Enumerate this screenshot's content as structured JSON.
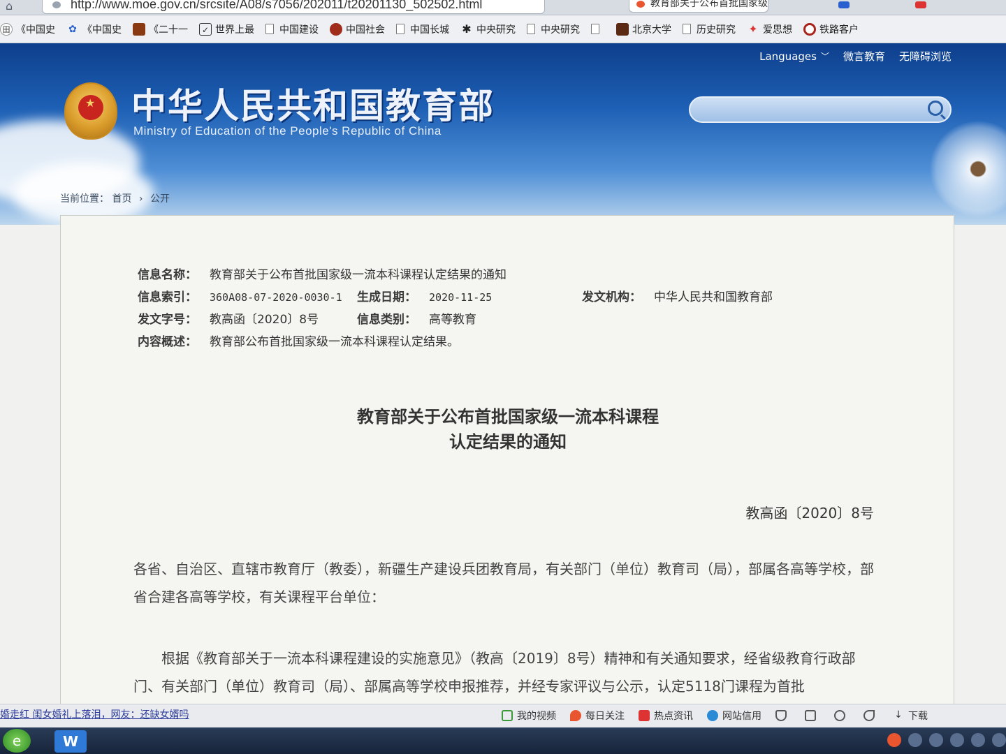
{
  "browser": {
    "url": "http://www.moe.gov.cn/srcsite/A08/s7056/202011/t20201130_502502.html",
    "tab_title": "教育部关于公布首批国家级",
    "bookmarks": [
      {
        "label": "《中国史",
        "icon": "app-icon"
      },
      {
        "label": "《中国史",
        "icon": "paw-icon"
      },
      {
        "label": "《二十一",
        "icon": "book-icon"
      },
      {
        "label": "世界上最",
        "icon": "check-icon"
      },
      {
        "label": "中国建设",
        "icon": "doc-icon"
      },
      {
        "label": "中国社会",
        "icon": "globe-icon"
      },
      {
        "label": "中国长城",
        "icon": "doc-icon"
      },
      {
        "label": "中央研究",
        "icon": "tree-icon"
      },
      {
        "label": "中央研究",
        "icon": "doc-icon"
      },
      {
        "label": "北京大学",
        "icon": "building-icon"
      },
      {
        "label": "历史研究",
        "icon": "doc-icon"
      },
      {
        "label": "爱思想",
        "icon": "star-icon"
      },
      {
        "label": "铁路客户",
        "icon": "train-icon"
      }
    ]
  },
  "site": {
    "top_links": {
      "languages": "Languages",
      "weibo": "微言教育",
      "accessible": "无障碍浏览"
    },
    "logo_cn": "中华人民共和国教育部",
    "logo_en": "Ministry of Education of the People's Republic of China",
    "breadcrumb": {
      "prefix": "当前位置：",
      "home": "首页",
      "sep": "›",
      "current": "公开"
    }
  },
  "meta": {
    "name_label": "信息名称：",
    "name_value": "教育部关于公布首批国家级一流本科课程认定结果的通知",
    "index_label": "信息索引：",
    "index_value": "360A08-07-2020-0030-1",
    "date_label": "生成日期：",
    "date_value": "2020-11-25",
    "issuer_label": "发文机构：",
    "issuer_value": "中华人民共和国教育部",
    "docno_label": "发文字号：",
    "docno_value": "教高函〔2020〕8号",
    "category_label": "信息类别：",
    "category_value": "高等教育",
    "summary_label": "内容概述：",
    "summary_value": "教育部公布首批国家级一流本科课程认定结果。"
  },
  "article": {
    "title_line1": "教育部关于公布首批国家级一流本科课程",
    "title_line2": "认定结果的通知",
    "doc_number": "教高函〔2020〕8号",
    "para1": "各省、自治区、直辖市教育厅（教委），新疆生产建设兵团教育局，有关部门（单位）教育司（局），部属各高等学校，部省合建各高等学校，有关课程平台单位：",
    "para2": "根据《教育部关于一流本科课程建设的实施意见》（教高〔2019〕8号）精神和有关通知要求，经省级教育行政部门、有关部门（单位）教育司（局）、部属高等学校申报推荐，并经专家评议与公示，认定5118门课程为首批"
  },
  "statusbar": {
    "news": "婚走红 闺女婚礼上落泪，网友：还缺女婿吗",
    "items": [
      "我的视频",
      "每日关注",
      "热点资讯",
      "网站信用"
    ],
    "download": "下载"
  },
  "colors": {
    "banner_top": "#0e3f8c",
    "banner_bottom": "#bcd6ee",
    "emblem": "#d99b2a",
    "accent_red": "#c8251f"
  }
}
